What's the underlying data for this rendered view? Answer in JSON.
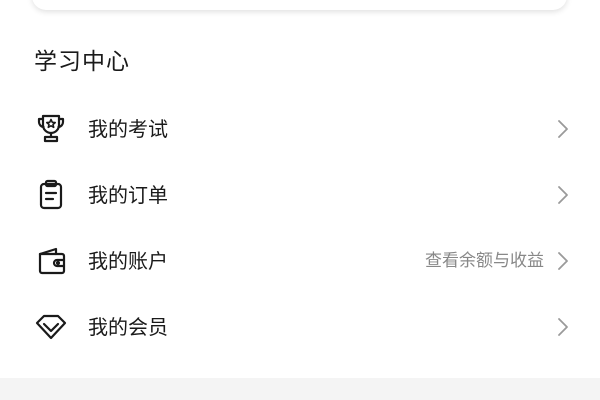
{
  "section": {
    "title": "学习中心"
  },
  "menu": {
    "items": [
      {
        "label": "我的考试",
        "hint": "",
        "icon": "trophy-icon"
      },
      {
        "label": "我的订单",
        "hint": "",
        "icon": "clipboard-icon"
      },
      {
        "label": "我的账户",
        "hint": "查看余额与收益",
        "icon": "wallet-icon"
      },
      {
        "label": "我的会员",
        "hint": "",
        "icon": "diamond-icon"
      }
    ]
  },
  "colors": {
    "text": "#1a1a1a",
    "hint": "#888888",
    "chevron": "#9a9a9a",
    "footer_band": "#f4f4f4"
  }
}
